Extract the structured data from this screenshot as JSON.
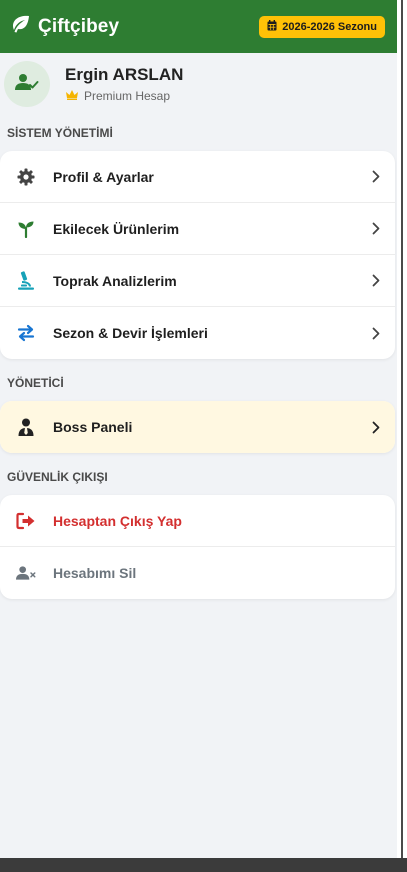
{
  "header": {
    "brand": "Çiftçibey",
    "season_badge": "2026-2026 Sezonu"
  },
  "profile": {
    "name": "Ergin ARSLAN",
    "membership": "Premium Hesap"
  },
  "sections": {
    "system": {
      "title": "SİSTEM YÖNETİMİ",
      "items": [
        {
          "label": "Profil & Ayarlar",
          "icon": "gear-icon"
        },
        {
          "label": "Ekilecek Ürünlerim",
          "icon": "seedling-icon"
        },
        {
          "label": "Toprak Analizlerim",
          "icon": "microscope-icon"
        },
        {
          "label": "Sezon & Devir İşlemleri",
          "icon": "exchange-arrows-icon"
        }
      ]
    },
    "admin": {
      "title": "YÖNETİCİ",
      "items": [
        {
          "label": "Boss Paneli",
          "icon": "user-tie-icon"
        }
      ]
    },
    "security": {
      "title": "GÜVENLİK ÇIKIŞI",
      "items": [
        {
          "label": "Hesaptan Çıkış Yap",
          "icon": "logout-icon"
        },
        {
          "label": "Hesabımı Sil",
          "icon": "user-delete-icon"
        }
      ]
    }
  },
  "colors": {
    "brand_green": "#2e7d32",
    "badge_yellow": "#ffc107",
    "logout_red": "#d32f2f",
    "boss_bg": "#fff8e1"
  }
}
